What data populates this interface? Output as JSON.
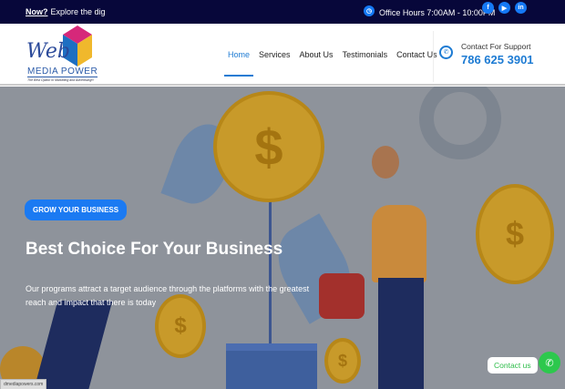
{
  "topbar": {
    "ticker_bold": "Now?",
    "ticker_text": "Explore the dig",
    "hours": "Office Hours 7:00AM - 10:00PM",
    "social": [
      "f",
      "▶",
      "in"
    ]
  },
  "logo": {
    "web": "Web",
    "name": "MEDIA POWER",
    "tagline": "The Best Option in Marketing and Advertising!!!"
  },
  "nav": [
    "Home",
    "Services",
    "About Us",
    "Testimonials",
    "Contact Us"
  ],
  "support": {
    "label": "Contact For Support",
    "phone": "786 625 3901"
  },
  "hero": {
    "badge": "GROW YOUR BUSINESS",
    "title": "Best Choice For Your Business",
    "description": "Our programs attract a target audience through the platforms with the greatest reach and impact that there is today",
    "coin_symbol": "$"
  },
  "floating": {
    "contact": "Contact us"
  },
  "status_url": "dmediapowers.com"
}
